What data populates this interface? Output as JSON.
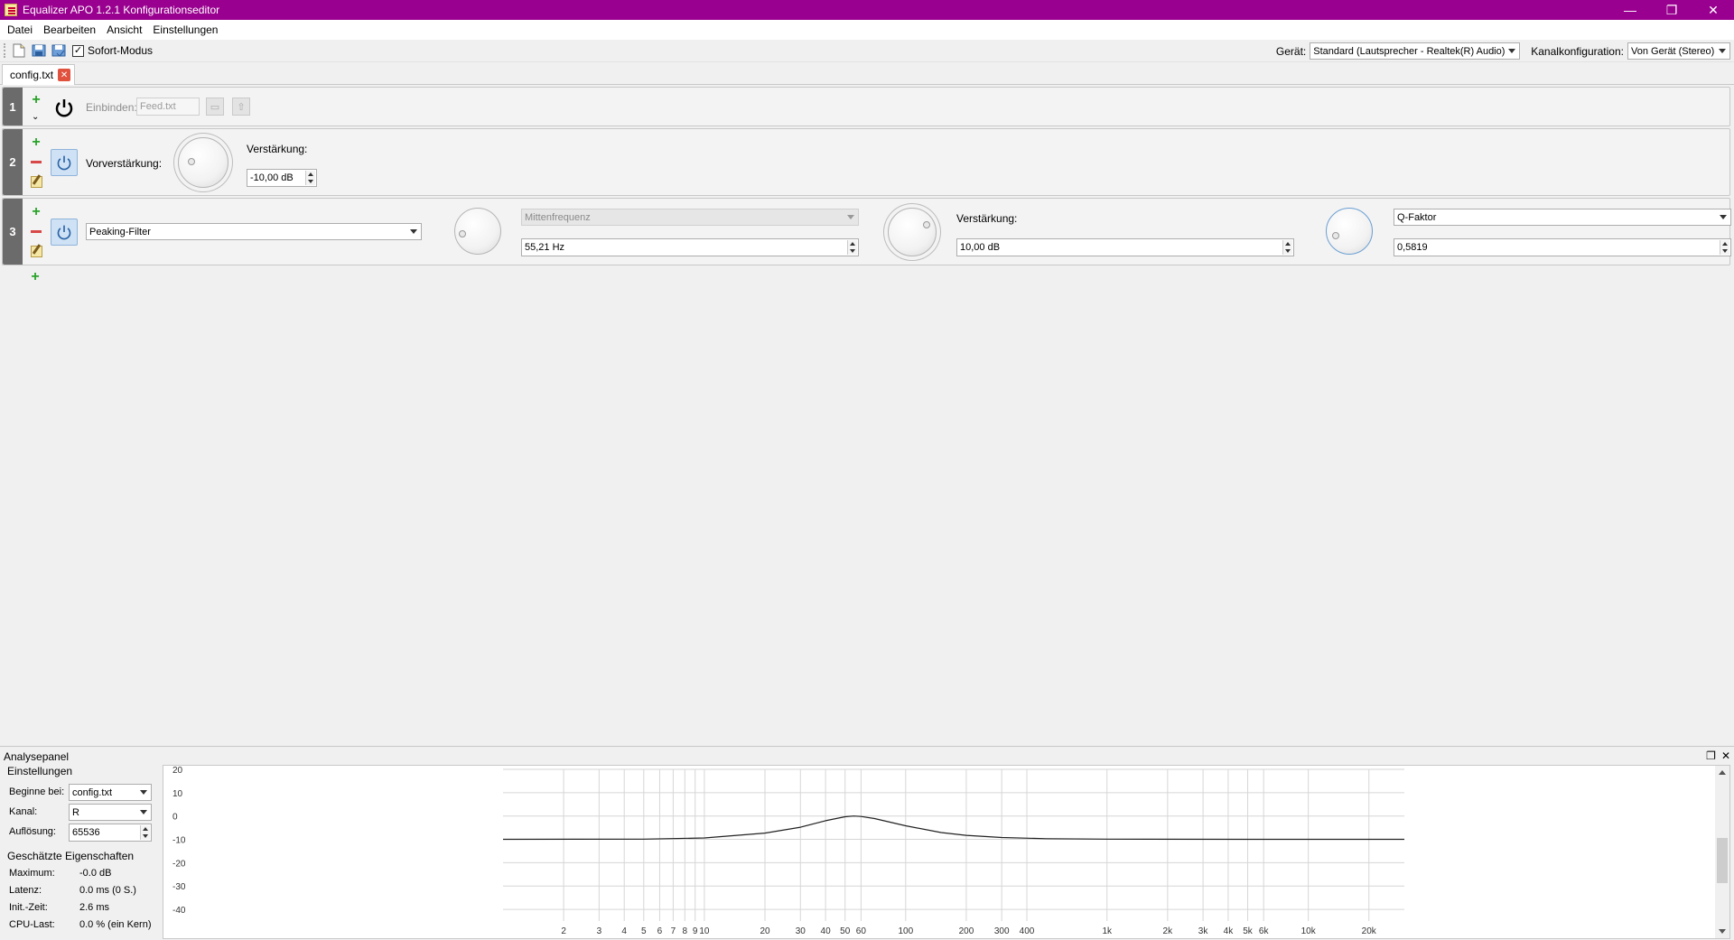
{
  "window": {
    "title": "Equalizer APO 1.2.1 Konfigurationseditor",
    "controls": {
      "minimize": "—",
      "maximize": "❐",
      "close": "✕"
    }
  },
  "menu": [
    "Datei",
    "Bearbeiten",
    "Ansicht",
    "Einstellungen"
  ],
  "toolbar": {
    "instant_mode_label": "Sofort-Modus",
    "instant_mode_checked": true,
    "device_label": "Gerät:",
    "device_value": "Standard (Lautsprecher - Realtek(R) Audio)",
    "channel_config_label": "Kanalkonfiguration:",
    "channel_config_value": "Von Gerät (Stereo)"
  },
  "tab": {
    "label": "config.txt"
  },
  "rows": {
    "row1": {
      "number": "1",
      "include_label": "Einbinden:",
      "include_file": "Feed.txt"
    },
    "row2": {
      "number": "2",
      "label": "Vorverstärkung:",
      "gain_label": "Verstärkung:",
      "gain_value": "-10,00 dB"
    },
    "row3": {
      "number": "3",
      "filter_type": "Peaking-Filter",
      "freq_select": "Mittenfrequenz",
      "freq_value": "55,21 Hz",
      "gain_label": "Verstärkung:",
      "gain_value": "10,00 dB",
      "q_select": "Q-Faktor",
      "q_value": "0,5819"
    }
  },
  "analysis": {
    "title": "Analysepanel",
    "settings_title": "Einstellungen",
    "start_label": "Beginne bei:",
    "start_value": "config.txt",
    "channel_label": "Kanal:",
    "channel_value": "R",
    "resolution_label": "Auflösung:",
    "resolution_value": "65536",
    "props_title": "Geschätzte Eigenschaften",
    "props": [
      {
        "label": "Maximum:",
        "value": "-0.0 dB"
      },
      {
        "label": "Latenz:",
        "value": "0.0 ms (0 S.)"
      },
      {
        "label": "Init.-Zeit:",
        "value": "2.6 ms"
      },
      {
        "label": "CPU-Last:",
        "value": "0.0 % (ein Kern)"
      }
    ]
  },
  "chart_data": {
    "type": "line",
    "xscale": "log",
    "xlim": [
      1,
      30000
    ],
    "ylim": [
      -45,
      20
    ],
    "yticks": [
      "20",
      "10",
      "0",
      "-10",
      "-20",
      "-30",
      "-40"
    ],
    "ytick_values": [
      20,
      10,
      0,
      -10,
      -20,
      -30,
      -40
    ],
    "xticks": [
      "2",
      "3",
      "4",
      "5",
      "6",
      "7",
      "8",
      "9",
      "10",
      "20",
      "30",
      "40",
      "50",
      "60",
      "100",
      "200",
      "300",
      "400",
      "1k",
      "2k",
      "3k",
      "4k",
      "5k",
      "6k",
      "10k",
      "20k"
    ],
    "xtick_values": [
      2,
      3,
      4,
      5,
      6,
      7,
      8,
      9,
      10,
      20,
      30,
      40,
      50,
      60,
      100,
      200,
      300,
      400,
      1000,
      2000,
      3000,
      4000,
      5000,
      6000,
      10000,
      20000
    ],
    "series": [
      {
        "color": "#222222",
        "x": [
          1,
          5,
          10,
          20,
          30,
          40,
          50,
          55.21,
          60,
          70,
          100,
          150,
          200,
          300,
          500,
          1000,
          5000,
          20000,
          30000
        ],
        "y": [
          -10,
          -9.9,
          -9.4,
          -7.3,
          -4.8,
          -2.0,
          -0.3,
          0,
          -0.2,
          -1.1,
          -4.2,
          -7.1,
          -8.3,
          -9.2,
          -9.7,
          -9.9,
          -10,
          -10,
          -10
        ]
      }
    ]
  }
}
